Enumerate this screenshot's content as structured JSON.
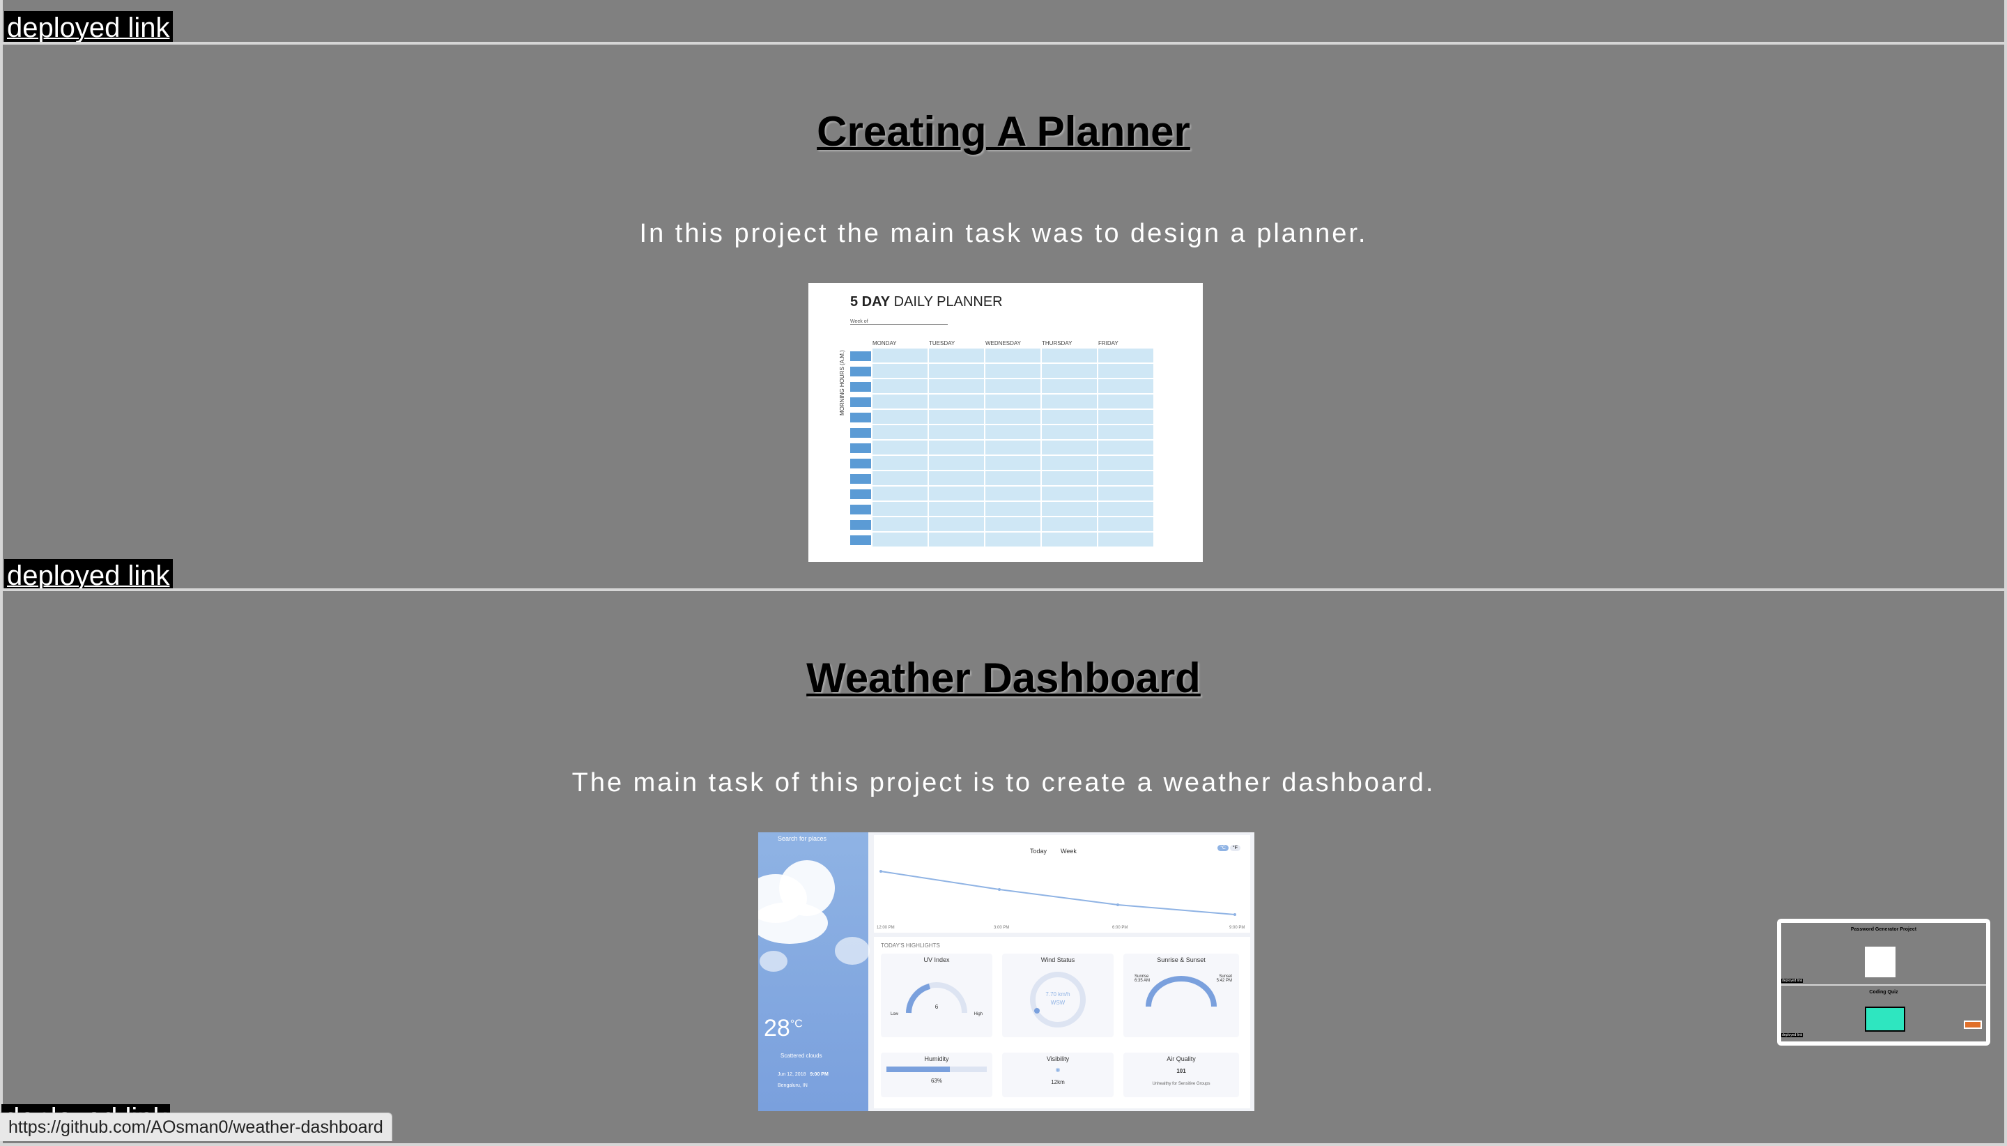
{
  "top_section": {
    "deploy_label": "deployed link"
  },
  "planner_section": {
    "title": "Creating A Planner",
    "description": "In this project the main task was to design a planner.",
    "deploy_label": "deployed link",
    "image": {
      "title_bold": "5 DAY",
      "title_rest": " DAILY PLANNER",
      "week_label": "Week of",
      "days": [
        "MONDAY",
        "TUESDAY",
        "WEDNESDAY",
        "THURSDAY",
        "FRIDAY"
      ],
      "side_label": "MORNING HOURS (A.M.)"
    }
  },
  "weather_section": {
    "title": "Weather Dashboard",
    "description": "The main task of this project is to create a weather dashboard.",
    "deploy_label": "deployed link",
    "image": {
      "search_placeholder": "Search for places",
      "temperature": "28",
      "temp_unit": "°C",
      "condition": "Scattered clouds",
      "date": "Jun 12, 2018",
      "time": "9:00 PM",
      "location": "Bengaluru, IN",
      "tab_today": "Today",
      "tab_week": "Week",
      "unit_c": "°C",
      "unit_f": "°F",
      "times": [
        "12:00 PM",
        "3:00 PM",
        "6:00 PM",
        "9:00 PM"
      ],
      "highlights_title": "TODAY'S HIGHLIGHTS",
      "cards": {
        "uv": {
          "title": "UV Index",
          "value": "6",
          "low": "Low",
          "high": "High"
        },
        "wind": {
          "title": "Wind Status",
          "value": "7.70 km/h",
          "dir": "WSW"
        },
        "sun": {
          "title": "Sunrise & Sunset",
          "sunrise_label": "Sunrise",
          "sunrise": "6:35 AM",
          "sunset_label": "Sunset",
          "sunset": "5:42 PM"
        },
        "humidity": {
          "title": "Humidity",
          "value": "63%"
        },
        "visibility": {
          "title": "Visibility",
          "value": "12km"
        },
        "air": {
          "title": "Air Quality",
          "value": "101",
          "note": "Unhealthy for Sensitive Groups"
        }
      }
    }
  },
  "thumbnail": {
    "title1": "Password Generator Project",
    "title2": "Coding Quiz",
    "deploy_label": "deployed link"
  },
  "status_bar": {
    "url": "https://github.com/AOsman0/weather-dashboard"
  },
  "colors": {
    "page_bg": "#808080",
    "divider": "#d6d6d6",
    "accent_teal": "#2ee6c0",
    "planner_blue": "#5b9bd5",
    "weather_blue": "#8fb3e4"
  }
}
